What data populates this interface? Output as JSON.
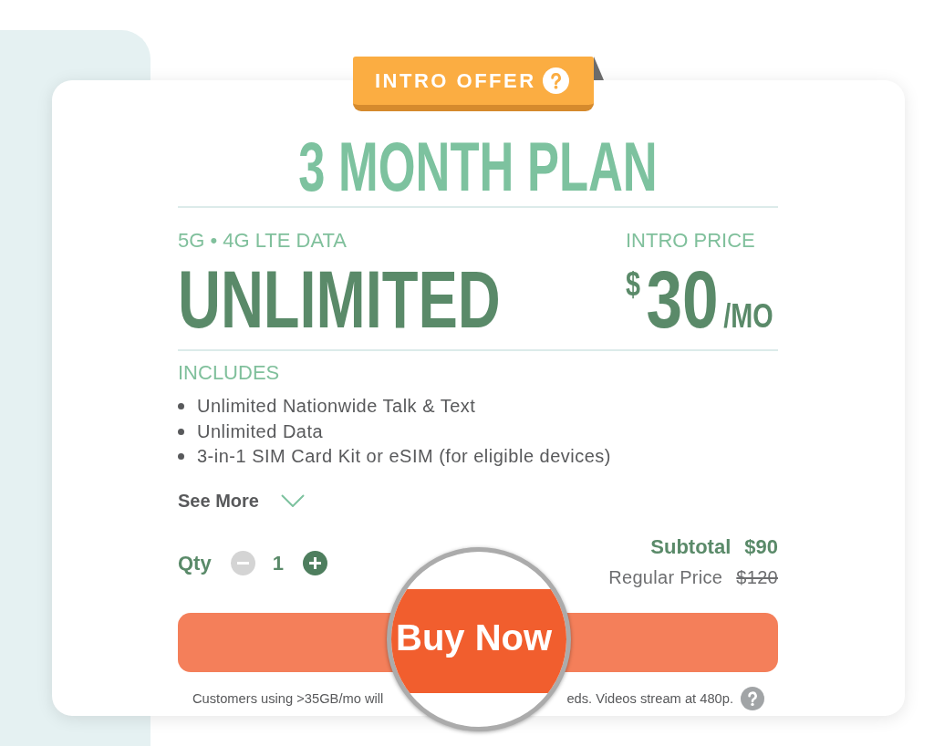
{
  "badge": {
    "label": "INTRO OFFER"
  },
  "plan": {
    "title": "3 MONTH PLAN"
  },
  "data": {
    "label": "5G • 4G LTE DATA",
    "amount": "UNLIMITED"
  },
  "price": {
    "label": "INTRO PRICE",
    "currency": "$",
    "amount": "30",
    "unit": "/MO"
  },
  "includes": {
    "heading": "INCLUDES",
    "items": [
      "Unlimited Nationwide Talk & Text",
      "Unlimited Data",
      "3-in-1 SIM Card Kit or eSIM (for eligible devices)"
    ]
  },
  "see_more": {
    "label": "See More",
    "expanded": false
  },
  "quantity": {
    "label": "Qty",
    "value": "1",
    "decrease": {
      "disabled": true
    },
    "increase": {
      "disabled": false
    }
  },
  "summary": {
    "subtotal_label": "Subtotal",
    "subtotal": "$90",
    "regular_label": "Regular Price",
    "regular": "$120",
    "regular_struck": true
  },
  "magnifier": {
    "label": "Buy Now"
  },
  "footnote": [
    "Customers using >35GB/mo will",
    "eds. Videos stream at 480p."
  ]
}
